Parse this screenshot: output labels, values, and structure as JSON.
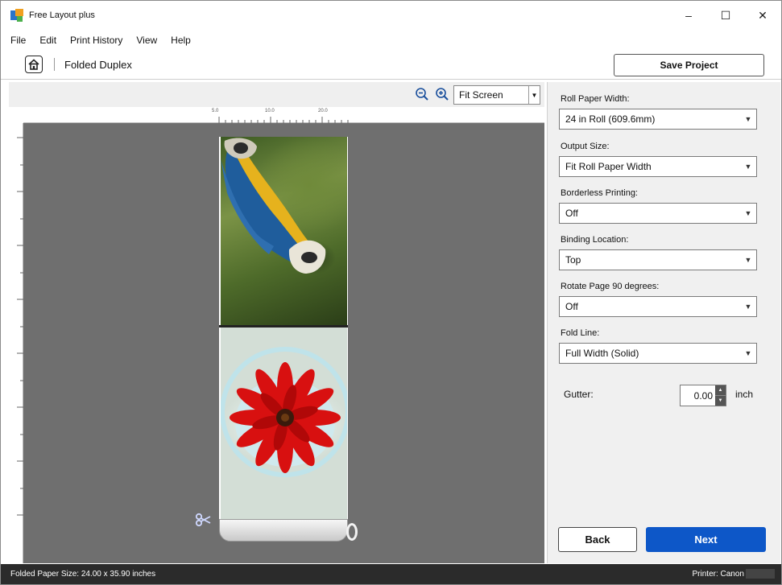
{
  "window": {
    "title": "Free Layout plus",
    "controls": {
      "minimize": "–",
      "maximize": "☐",
      "close": "✕"
    }
  },
  "menu": [
    "File",
    "Edit",
    "Print History",
    "View",
    "Help"
  ],
  "breadcrumb": {
    "home_icon": "home-icon",
    "current": "Folded Duplex"
  },
  "header": {
    "save_label": "Save Project"
  },
  "preview": {
    "zoom_value": "Fit Screen",
    "ruler_top_labels": [
      "5.0",
      "10.0",
      "20.0"
    ],
    "pages": [
      "parrot-photo",
      "gerbera-flower-photo"
    ]
  },
  "settings": {
    "roll_paper_width": {
      "label": "Roll Paper Width:",
      "value": "24 in Roll (609.6mm)"
    },
    "output_size": {
      "label": "Output Size:",
      "value": "Fit Roll Paper Width"
    },
    "borderless": {
      "label": "Borderless Printing:",
      "value": "Off"
    },
    "binding": {
      "label": "Binding Location:",
      "value": "Top"
    },
    "rotate": {
      "label": "Rotate Page 90 degrees:",
      "value": "Off"
    },
    "fold_line": {
      "label": "Fold Line:",
      "value": "Full Width (Solid)"
    },
    "gutter": {
      "label": "Gutter:",
      "value": "0.00",
      "unit": "inch"
    }
  },
  "buttons": {
    "back": "Back",
    "next": "Next"
  },
  "colors": {
    "primary": "#0d57c8",
    "canvas": "#6f6f6f",
    "statusbar": "#2b2b2b"
  },
  "status": {
    "left": "Folded Paper Size: 24.00 x 35.90 inches",
    "right": "Printer: Canon"
  }
}
